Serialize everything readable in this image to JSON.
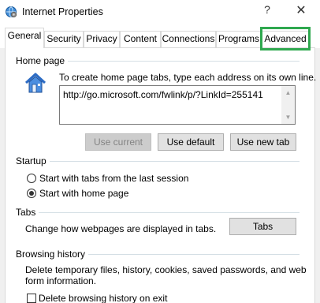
{
  "window": {
    "title": "Internet Properties",
    "help_label": "?",
    "close_label": "✕"
  },
  "tabs": [
    {
      "label": "General",
      "active": true
    },
    {
      "label": "Security",
      "active": false
    },
    {
      "label": "Privacy",
      "active": false
    },
    {
      "label": "Content",
      "active": false
    },
    {
      "label": "Connections",
      "active": false
    },
    {
      "label": "Programs",
      "active": false
    },
    {
      "label": "Advanced",
      "active": false,
      "highlighted": true
    }
  ],
  "highlight_color": "#2fa84f",
  "home_page": {
    "group_label": "Home page",
    "icon": "house-icon",
    "description": "To create home page tabs, type each address on its own line.",
    "url": "http://go.microsoft.com/fwlink/p/?LinkId=255141",
    "buttons": {
      "use_current": "Use current",
      "use_default": "Use default",
      "use_new_tab": "Use new tab"
    }
  },
  "startup": {
    "group_label": "Startup",
    "options": [
      {
        "label": "Start with tabs from the last session",
        "checked": false
      },
      {
        "label": "Start with home page",
        "checked": true
      }
    ]
  },
  "tabs_section": {
    "group_label": "Tabs",
    "description": "Change how webpages are displayed in tabs.",
    "button": "Tabs"
  },
  "browsing_history": {
    "group_label": "Browsing history",
    "description_line1": "Delete temporary files, history, cookies, saved passwords, and web",
    "description_line2": "form information.",
    "checkbox_label": "Delete browsing history on exit",
    "checkbox_checked": false
  }
}
